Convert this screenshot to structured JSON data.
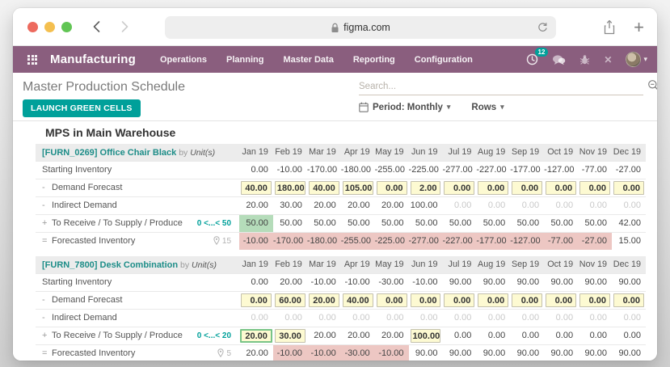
{
  "colors": {
    "navbar_purple": "#8a5e7e",
    "accent_teal": "#00a09a",
    "cell_yellow": "#fdfad2",
    "cell_green": "#b5dcba",
    "cell_red": "#edc7c3",
    "traffic_red": "#ed6a5e",
    "traffic_yellow": "#f4bf4f",
    "traffic_green": "#61c554"
  },
  "browser": {
    "url": "figma.com"
  },
  "navbar": {
    "app_name": "Manufacturing",
    "menus": [
      "Operations",
      "Planning",
      "Master Data",
      "Reporting",
      "Configuration"
    ],
    "activity_count": "12"
  },
  "toolbar": {
    "title": "Master Production Schedule",
    "launch_button": "LAUNCH GREEN CELLS",
    "search_placeholder": "Search...",
    "period_filter": "Period: Monthly",
    "rows_filter": "Rows"
  },
  "mps": {
    "heading": "MPS in Main Warehouse",
    "months": [
      "Jan 19",
      "Feb 19",
      "Mar 19",
      "Apr 19",
      "May 19",
      "Jun 19",
      "Jul 19",
      "Aug 19",
      "Sep 19",
      "Oct 19",
      "Nov 19",
      "Dec 19"
    ],
    "products": [
      {
        "name": "[FURN_0269] Office Chair Black",
        "by_label": "by",
        "uom": "Unit(s)",
        "receive_rule": "0 <...< 50",
        "forecast_target": "15",
        "rows": [
          {
            "key": "starting",
            "prefix": "",
            "label": "Starting Inventory",
            "cells": [
              [
                "0.00",
                "p"
              ],
              [
                "-10.00",
                "p"
              ],
              [
                "-170.00",
                "p"
              ],
              [
                "-180.00",
                "p"
              ],
              [
                "-255.00",
                "p"
              ],
              [
                "-225.00",
                "p"
              ],
              [
                "-277.00",
                "p"
              ],
              [
                "-227.00",
                "p"
              ],
              [
                "-177.00",
                "p"
              ],
              [
                "-127.00",
                "p"
              ],
              [
                "-77.00",
                "p"
              ],
              [
                "-27.00",
                "p"
              ]
            ]
          },
          {
            "key": "demand",
            "prefix": "-",
            "label": "Demand Forecast",
            "cells": [
              [
                "40.00",
                "i"
              ],
              [
                "180.00",
                "i"
              ],
              [
                "40.00",
                "i"
              ],
              [
                "105.00",
                "i"
              ],
              [
                "0.00",
                "i"
              ],
              [
                "2.00",
                "i"
              ],
              [
                "0.00",
                "i"
              ],
              [
                "0.00",
                "i"
              ],
              [
                "0.00",
                "i"
              ],
              [
                "0.00",
                "i"
              ],
              [
                "0.00",
                "i"
              ],
              [
                "0.00",
                "i"
              ]
            ]
          },
          {
            "key": "indirect",
            "prefix": "-",
            "label": "Indirect Demand",
            "cells": [
              [
                "20.00",
                "p"
              ],
              [
                "30.00",
                "p"
              ],
              [
                "20.00",
                "p"
              ],
              [
                "20.00",
                "p"
              ],
              [
                "20.00",
                "p"
              ],
              [
                "100.00",
                "p"
              ],
              [
                "0.00",
                "m"
              ],
              [
                "0.00",
                "m"
              ],
              [
                "0.00",
                "m"
              ],
              [
                "0.00",
                "m"
              ],
              [
                "0.00",
                "m"
              ],
              [
                "0.00",
                "m"
              ]
            ]
          },
          {
            "key": "receive",
            "prefix": "+",
            "label": "To Receive / To Supply / Produce",
            "cells": [
              [
                "50.00",
                "g"
              ],
              [
                "50.00",
                "p"
              ],
              [
                "50.00",
                "p"
              ],
              [
                "50.00",
                "p"
              ],
              [
                "50.00",
                "p"
              ],
              [
                "50.00",
                "p"
              ],
              [
                "50.00",
                "p"
              ],
              [
                "50.00",
                "p"
              ],
              [
                "50.00",
                "p"
              ],
              [
                "50.00",
                "p"
              ],
              [
                "50.00",
                "p"
              ],
              [
                "42.00",
                "p"
              ]
            ]
          },
          {
            "key": "forecast",
            "prefix": "=",
            "label": "Forecasted Inventory",
            "cells": [
              [
                "-10.00",
                "r"
              ],
              [
                "-170.00",
                "r"
              ],
              [
                "-180.00",
                "r"
              ],
              [
                "-255.00",
                "r"
              ],
              [
                "-225.00",
                "r"
              ],
              [
                "-277.00",
                "r"
              ],
              [
                "-227.00",
                "r"
              ],
              [
                "-177.00",
                "r"
              ],
              [
                "-127.00",
                "r"
              ],
              [
                "-77.00",
                "r"
              ],
              [
                "-27.00",
                "r"
              ],
              [
                "15.00",
                "p"
              ]
            ]
          }
        ]
      },
      {
        "name": "[FURN_7800] Desk Combination",
        "by_label": "by",
        "uom": "Unit(s)",
        "receive_rule": "0 <...< 20",
        "forecast_target": "5",
        "rows": [
          {
            "key": "starting",
            "prefix": "",
            "label": "Starting Inventory",
            "cells": [
              [
                "0.00",
                "p"
              ],
              [
                "20.00",
                "p"
              ],
              [
                "-10.00",
                "p"
              ],
              [
                "-10.00",
                "p"
              ],
              [
                "-30.00",
                "p"
              ],
              [
                "-10.00",
                "p"
              ],
              [
                "90.00",
                "p"
              ],
              [
                "90.00",
                "p"
              ],
              [
                "90.00",
                "p"
              ],
              [
                "90.00",
                "p"
              ],
              [
                "90.00",
                "p"
              ],
              [
                "90.00",
                "p"
              ]
            ]
          },
          {
            "key": "demand",
            "prefix": "-",
            "label": "Demand Forecast",
            "cells": [
              [
                "0.00",
                "i"
              ],
              [
                "60.00",
                "i"
              ],
              [
                "20.00",
                "i"
              ],
              [
                "40.00",
                "i"
              ],
              [
                "0.00",
                "i"
              ],
              [
                "0.00",
                "i"
              ],
              [
                "0.00",
                "i"
              ],
              [
                "0.00",
                "i"
              ],
              [
                "0.00",
                "i"
              ],
              [
                "0.00",
                "i"
              ],
              [
                "0.00",
                "i"
              ],
              [
                "0.00",
                "i"
              ]
            ]
          },
          {
            "key": "indirect",
            "prefix": "-",
            "label": "Indirect Demand",
            "cells": [
              [
                "0.00",
                "m"
              ],
              [
                "0.00",
                "m"
              ],
              [
                "0.00",
                "m"
              ],
              [
                "0.00",
                "m"
              ],
              [
                "0.00",
                "m"
              ],
              [
                "0.00",
                "m"
              ],
              [
                "0.00",
                "m"
              ],
              [
                "0.00",
                "m"
              ],
              [
                "0.00",
                "m"
              ],
              [
                "0.00",
                "m"
              ],
              [
                "0.00",
                "m"
              ],
              [
                "0.00",
                "m"
              ]
            ]
          },
          {
            "key": "receive",
            "prefix": "+",
            "label": "To Receive / To Supply / Produce",
            "cells": [
              [
                "20.00",
                "ig"
              ],
              [
                "30.00",
                "i"
              ],
              [
                "20.00",
                "p"
              ],
              [
                "20.00",
                "p"
              ],
              [
                "20.00",
                "p"
              ],
              [
                "100.00",
                "i"
              ],
              [
                "0.00",
                "p"
              ],
              [
                "0.00",
                "p"
              ],
              [
                "0.00",
                "p"
              ],
              [
                "0.00",
                "p"
              ],
              [
                "0.00",
                "p"
              ],
              [
                "0.00",
                "p"
              ]
            ]
          },
          {
            "key": "forecast",
            "prefix": "=",
            "label": "Forecasted Inventory",
            "cells": [
              [
                "20.00",
                "p"
              ],
              [
                "-10.00",
                "r"
              ],
              [
                "-10.00",
                "r"
              ],
              [
                "-30.00",
                "r"
              ],
              [
                "-10.00",
                "r"
              ],
              [
                "90.00",
                "p"
              ],
              [
                "90.00",
                "p"
              ],
              [
                "90.00",
                "p"
              ],
              [
                "90.00",
                "p"
              ],
              [
                "90.00",
                "p"
              ],
              [
                "90.00",
                "p"
              ],
              [
                "90.00",
                "p"
              ]
            ]
          }
        ]
      }
    ]
  }
}
